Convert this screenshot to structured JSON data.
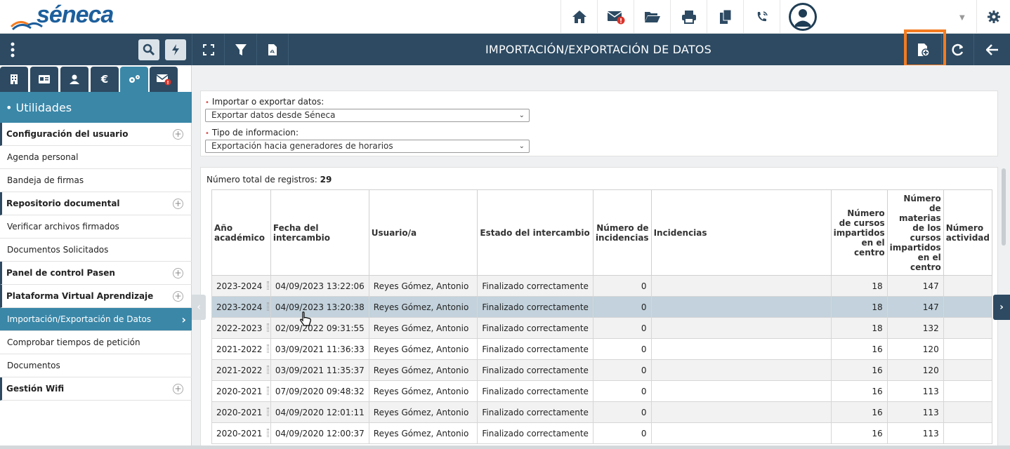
{
  "app": {
    "logo_text": "séneca",
    "title": "IMPORTACIÓN/EXPORTACIÓN DE DATOS"
  },
  "topbar": {
    "icons": [
      "home-icon",
      "mail-alert-icon",
      "folder-open-icon",
      "print-icon",
      "copy-icon",
      "phone-icon",
      "user-avatar",
      "gear-icon"
    ]
  },
  "toolbar": {
    "left_icons": [
      "menu-dots-icon",
      "search-icon",
      "bolt-icon",
      "fullscreen-icon",
      "filter-icon",
      "pdf-icon"
    ],
    "right_icons": [
      "new-document-icon",
      "refresh-icon",
      "back-arrow-icon"
    ]
  },
  "sidebar": {
    "tabs": [
      "building-icon",
      "id-card-icon",
      "users-icon",
      "euro-icon",
      "cogs-icon",
      "mail-alert-icon"
    ],
    "tab_euro": "€",
    "section": "• Utilidades",
    "items": [
      {
        "label": "Configuración del usuario",
        "bold": true,
        "expandable": true
      },
      {
        "label": "Agenda personal"
      },
      {
        "label": "Bandeja de firmas"
      },
      {
        "label": "Repositorio documental",
        "bold": true,
        "expandable": true
      },
      {
        "label": "Verificar archivos firmados"
      },
      {
        "label": "Documentos Solicitados"
      },
      {
        "label": "Panel de control Pasen",
        "bold": true,
        "expandable": true
      },
      {
        "label": "Plataforma Virtual Aprendizaje",
        "bold": true,
        "expandable": true
      },
      {
        "label": "Importación/Exportación de Datos",
        "active": true
      },
      {
        "label": "Comprobar tiempos de petición"
      },
      {
        "label": "Documentos"
      },
      {
        "label": "Gestión Wifi",
        "bold": true,
        "expandable": true
      }
    ]
  },
  "form": {
    "field1_label": "Importar o exportar datos:",
    "field1_value": "Exportar datos desde Séneca",
    "field2_label": "Tipo de informacion:",
    "field2_value": "Exportación hacia generadores de horarios"
  },
  "grid": {
    "total_label": "Número total de registros:",
    "total_value": "29",
    "headers": [
      "Año académico",
      "Fecha del intercambio",
      "Usuario/a",
      "Estado del intercambio",
      "Número de incidencias",
      "Incidencias",
      "Número de cursos impartidos en el centro",
      "Número de materias de los cursos impartidos en el centro",
      "Número actividad"
    ],
    "rows": [
      [
        "2023-2024",
        "04/09/2023 13:22:06",
        "Reyes Gómez, Antonio",
        "Finalizado correctamente",
        "0",
        "",
        "18",
        "147"
      ],
      [
        "2023-2024",
        "04/09/2023 13:20:38",
        "Reyes Gómez, Antonio",
        "Finalizado correctamente",
        "0",
        "",
        "18",
        "147"
      ],
      [
        "2022-2023",
        "02/09/2022 09:31:55",
        "Reyes Gómez, Antonio",
        "Finalizado correctamente",
        "0",
        "",
        "18",
        "132"
      ],
      [
        "2021-2022",
        "03/09/2021 11:36:33",
        "Reyes Gómez, Antonio",
        "Finalizado correctamente",
        "0",
        "",
        "16",
        "120"
      ],
      [
        "2021-2022",
        "03/09/2021 11:35:37",
        "Reyes Gómez, Antonio",
        "Finalizado correctamente",
        "0",
        "",
        "16",
        "120"
      ],
      [
        "2020-2021",
        "07/09/2020 09:48:32",
        "Reyes Gómez, Antonio",
        "Finalizado correctamente",
        "0",
        "",
        "16",
        "113"
      ],
      [
        "2020-2021",
        "04/09/2020 12:01:11",
        "Reyes Gómez, Antonio",
        "Finalizado correctamente",
        "0",
        "",
        "16",
        "113"
      ],
      [
        "2020-2021",
        "04/09/2020 12:00:37",
        "Reyes Gómez, Antonio",
        "Finalizado correctamente",
        "0",
        "",
        "16",
        "113"
      ]
    ],
    "selected_row": 1
  },
  "colors": {
    "toolbar": "#2d4a62",
    "accent": "#3a87a8",
    "highlight": "#f47b20",
    "selected_row": "#c3d2dc"
  }
}
